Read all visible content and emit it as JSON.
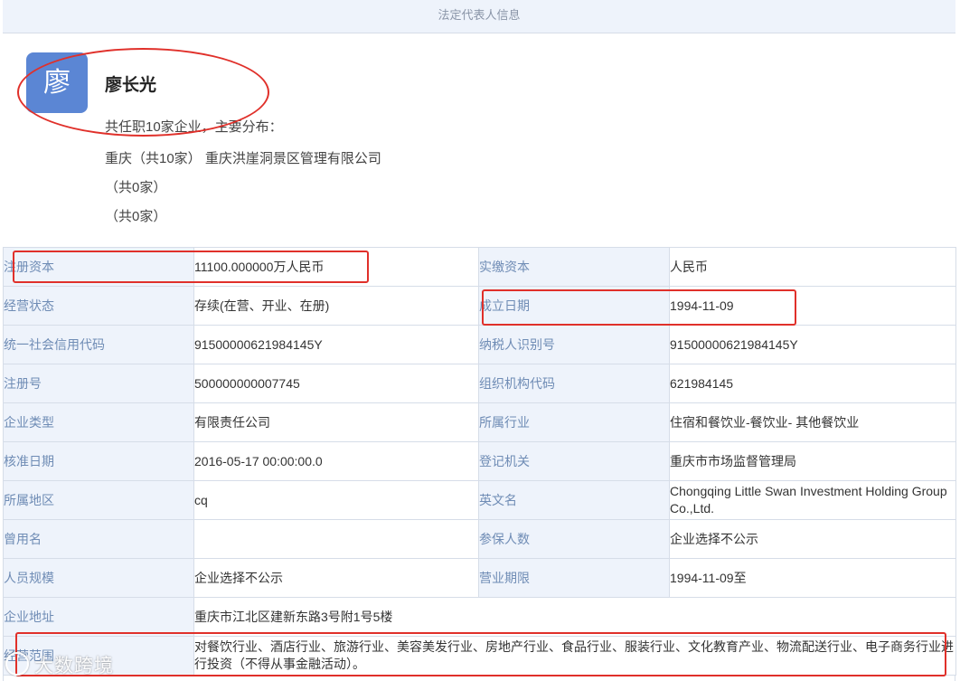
{
  "section_title": "法定代表人信息",
  "person": {
    "avatar_char": "廖",
    "name": "廖长光",
    "summary": "共任职10家企业，主要分布：",
    "distribution": [
      "重庆（共10家） 重庆洪崖洞景区管理有限公司",
      "（共0家）",
      "（共0家）"
    ]
  },
  "rows": [
    {
      "l1": "注册资本",
      "v1": "11100.000000万人民币",
      "l2": "实缴资本",
      "v2": "人民币"
    },
    {
      "l1": "经营状态",
      "v1": "存续(在营、开业、在册)",
      "l2": "成立日期",
      "v2": "1994-11-09"
    },
    {
      "l1": "统一社会信用代码",
      "v1": "91500000621984145Y",
      "l2": "纳税人识别号",
      "v2": "91500000621984145Y"
    },
    {
      "l1": "注册号",
      "v1": "500000000007745",
      "l2": "组织机构代码",
      "v2": "621984145"
    },
    {
      "l1": "企业类型",
      "v1": "有限责任公司",
      "l2": "所属行业",
      "v2": "住宿和餐饮业-餐饮业- 其他餐饮业"
    },
    {
      "l1": "核准日期",
      "v1": "2016-05-17 00:00:00.0",
      "l2": "登记机关",
      "v2": "重庆市市场监督管理局"
    },
    {
      "l1": "所属地区",
      "v1": "cq",
      "l2": "英文名",
      "v2": "Chongqing Little Swan Investment Holding Group Co.,Ltd."
    },
    {
      "l1": "曾用名",
      "v1": "",
      "l2": "参保人数",
      "v2": "企业选择不公示"
    },
    {
      "l1": "人员规模",
      "v1": "企业选择不公示",
      "l2": "营业期限",
      "v2": "1994-11-09至"
    }
  ],
  "address": {
    "label": "企业地址",
    "value": "重庆市江北区建新东路3号附1号5楼"
  },
  "scope": {
    "label": "经营范围",
    "value": "对餐饮行业、酒店行业、旅游行业、美容美发行业、房地产行业、食品行业、服装行业、文化教育产业、物流配送行业、电子商务行业进行投资（不得从事金融活动）。"
  },
  "watermark": "大数跨境",
  "annotation_color": "#e0302a"
}
